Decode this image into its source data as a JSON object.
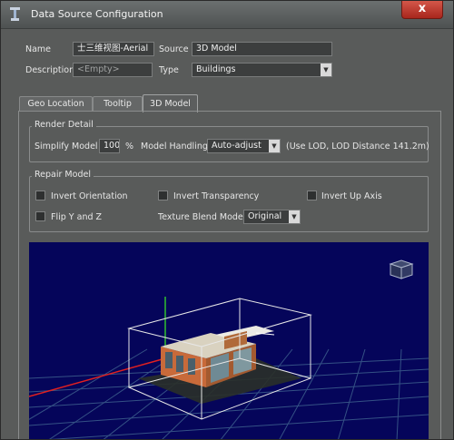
{
  "window": {
    "title": "Data Source Configuration",
    "close_label": "x"
  },
  "form": {
    "name_label": "Name",
    "name_value": "士三维视图-Aerial",
    "source_label": "Source",
    "source_value": "3D Model",
    "description_label": "Description",
    "description_placeholder": "<Empty>",
    "type_label": "Type",
    "type_value": "Buildings"
  },
  "tabs": [
    {
      "label": "Geo Location",
      "active": false
    },
    {
      "label": "Tooltip",
      "active": false
    },
    {
      "label": "3D Model",
      "active": true
    }
  ],
  "render_detail": {
    "title": "Render Detail",
    "simplify_label": "Simplify Model",
    "simplify_value": "100",
    "percent_symbol": "%",
    "handling_label": "Model Handling",
    "handling_value": "Auto-adjust",
    "lod_note": "(Use LOD, LOD Distance 141.2m)"
  },
  "repair_model": {
    "title": "Repair Model",
    "invert_orientation": "Invert Orientation",
    "invert_transparency": "Invert Transparency",
    "invert_up_axis": "Invert Up Axis",
    "flip_yz": "Flip Y and Z",
    "texture_blend_label": "Texture Blend Mode",
    "texture_blend_value": "Original"
  },
  "colors": {
    "viewport_bg": "#05055a",
    "grid": "#3a5a8a",
    "axis_red": "#e02020",
    "bbox": "#e8e8e8",
    "building": "#c86a3a"
  }
}
